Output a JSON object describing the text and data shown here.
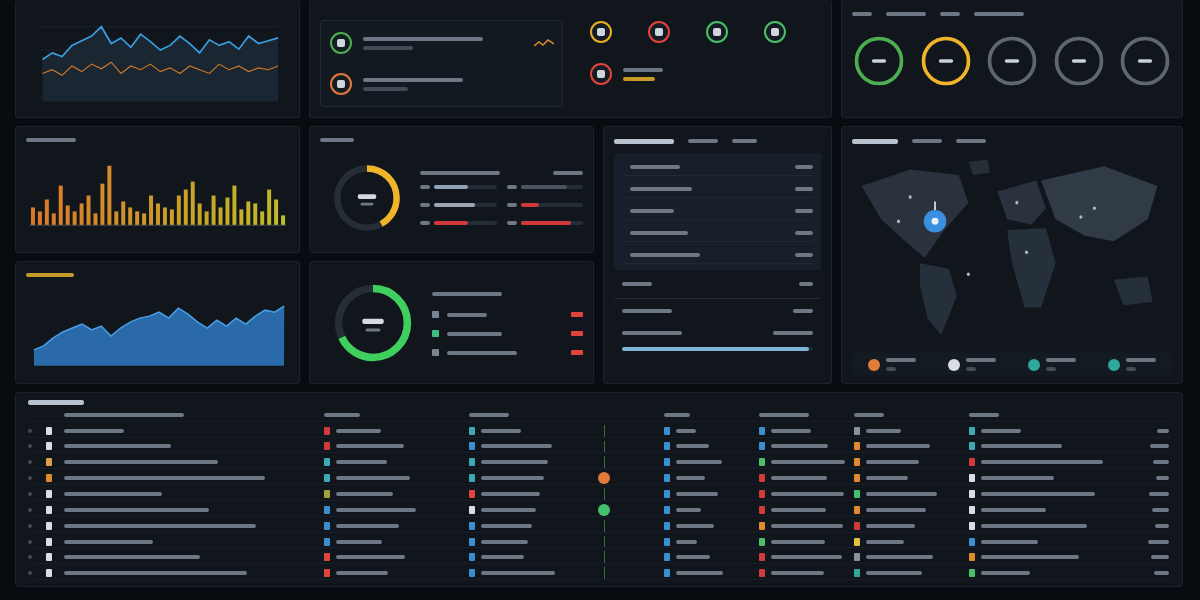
{
  "status_panel": {
    "items": [
      {
        "color": "#4caf50"
      },
      {
        "color": "#e07b39"
      }
    ],
    "circles": [
      {
        "color": "#e6b022"
      },
      {
        "color": "#e0443c"
      },
      {
        "color": "#46c06a"
      },
      {
        "color": "#46c06a"
      },
      {
        "color": "#e0443c"
      }
    ]
  },
  "rings": [
    {
      "color": "#4caf50",
      "level": 1
    },
    {
      "color": "#f0b429",
      "level": 1
    },
    {
      "color": "#5f6770",
      "level": 1
    },
    {
      "color": "#5f6770",
      "level": 1
    },
    {
      "color": "#5f6770",
      "level": 1
    }
  ],
  "gauge_panel": {
    "color": "#f0b429",
    "level": 0.42,
    "meters": [
      {
        "color": "#8fa3b8",
        "level": 0.55
      },
      {
        "color": "#4a5561",
        "level": 0.75
      },
      {
        "color": "#9aa6b2",
        "level": 0.65
      },
      {
        "color": "#d03a3a",
        "level": 0.3
      },
      {
        "color": "#d03a3a",
        "level": 0.55
      },
      {
        "color": "#d03a3a",
        "level": 0.8
      }
    ]
  },
  "green_panel": {
    "color": "#3fcf5f",
    "level": 0.68,
    "rows": [
      {
        "color": "#7a8594",
        "badge": {
          "color": "#e0443c"
        }
      },
      {
        "color": "#3fbf7f",
        "badge": {
          "color": "#e0443c"
        }
      },
      {
        "color": "#7a8594",
        "badge": {
          "color": "#e0443c"
        }
      }
    ]
  },
  "list_panel": {
    "progress": {
      "level": 0.98
    }
  },
  "map_panel": {
    "legend": [
      {
        "color": "#e07b39"
      },
      {
        "color": "#d9dee3"
      },
      {
        "color": "#2fa89a"
      },
      {
        "color": "#2fa89a"
      }
    ]
  },
  "table": {
    "rows": [
      {
        "icons": [
          {
            "color": "#d9dee3"
          },
          {
            "color": "#d03a3a"
          },
          {
            "color": "#3fa8b8"
          },
          {
            "color": "#3a8fd0"
          },
          {
            "color": "#3a8fd0"
          },
          {
            "color": "#8a929a"
          },
          {
            "color": "#3fa8b8"
          }
        ]
      },
      {
        "icons": [
          {
            "color": "#d9dee3"
          },
          {
            "color": "#d03a3a"
          },
          {
            "color": "#3a8fd0"
          },
          {
            "color": "#3a8fd0"
          },
          {
            "color": "#3a8fd0"
          },
          {
            "color": "#e08a2a"
          },
          {
            "color": "#3fa8b8"
          }
        ]
      },
      {
        "icons": [
          {
            "color": "#e0a040"
          },
          {
            "color": "#3fa8b8"
          },
          {
            "color": "#3fa8b8"
          },
          {
            "color": "#3a8fd0"
          },
          {
            "color": "#46c06a"
          },
          {
            "color": "#e08a2a"
          },
          {
            "color": "#d03a3a"
          }
        ]
      },
      {
        "icons": [
          {
            "color": "#e08a2a"
          },
          {
            "color": "#3fa8b8"
          },
          {
            "color": "#3fa8b8"
          },
          {
            "color": "#3a8fd0"
          },
          {
            "color": "#d03a3a"
          },
          {
            "color": "#e08a2a"
          },
          {
            "color": "#d9dee3"
          }
        ],
        "marker": {
          "color": "#e07b39"
        }
      },
      {
        "icons": [
          {
            "color": "#d9dee3"
          },
          {
            "color": "#a0a040"
          },
          {
            "color": "#e0443c"
          },
          {
            "color": "#3a8fd0"
          },
          {
            "color": "#d03a3a"
          },
          {
            "color": "#46c06a"
          },
          {
            "color": "#d9dee3"
          }
        ]
      },
      {
        "icons": [
          {
            "color": "#d9dee3"
          },
          {
            "color": "#3a8fd0"
          },
          {
            "color": "#d9dee3"
          },
          {
            "color": "#3a8fd0"
          },
          {
            "color": "#d03a3a"
          },
          {
            "color": "#e08a2a"
          },
          {
            "color": "#d9dee3"
          }
        ],
        "marker": {
          "color": "#46c06a"
        }
      },
      {
        "icons": [
          {
            "color": "#d9dee3"
          },
          {
            "color": "#3a8fd0"
          },
          {
            "color": "#3a8fd0"
          },
          {
            "color": "#3a8fd0"
          },
          {
            "color": "#e08a2a"
          },
          {
            "color": "#d03a3a"
          },
          {
            "color": "#d9dee3"
          }
        ]
      },
      {
        "icons": [
          {
            "color": "#d9dee3"
          },
          {
            "color": "#3a8fd0"
          },
          {
            "color": "#3a8fd0"
          },
          {
            "color": "#3a8fd0"
          },
          {
            "color": "#46c06a"
          },
          {
            "color": "#e0c040"
          },
          {
            "color": "#3a8fd0"
          }
        ]
      },
      {
        "icons": [
          {
            "color": "#d9dee3"
          },
          {
            "color": "#e0443c"
          },
          {
            "color": "#3a8fd0"
          },
          {
            "color": "#3a8fd0"
          },
          {
            "color": "#d03a3a"
          },
          {
            "color": "#8a929a"
          },
          {
            "color": "#e08a2a"
          }
        ]
      },
      {
        "icons": [
          {
            "color": "#d9dee3"
          },
          {
            "color": "#e0443c"
          },
          {
            "color": "#3a8fd0"
          },
          {
            "color": "#3a8fd0"
          },
          {
            "color": "#d03a3a"
          },
          {
            "color": "#2fa89a"
          },
          {
            "color": "#46c06a"
          }
        ]
      }
    ]
  }
}
